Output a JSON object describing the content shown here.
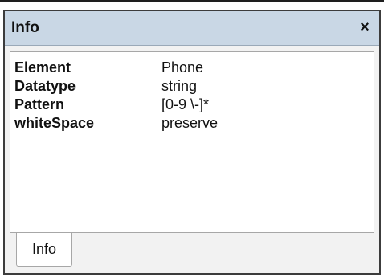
{
  "panel": {
    "title": "Info",
    "close_label": "×"
  },
  "properties": [
    {
      "key": "Element",
      "value": "Phone"
    },
    {
      "key": "Datatype",
      "value": "string"
    },
    {
      "key": "Pattern",
      "value": "[0-9 \\-]*"
    },
    {
      "key": "whiteSpace",
      "value": "preserve"
    }
  ],
  "tabs": [
    {
      "label": "Info"
    }
  ]
}
